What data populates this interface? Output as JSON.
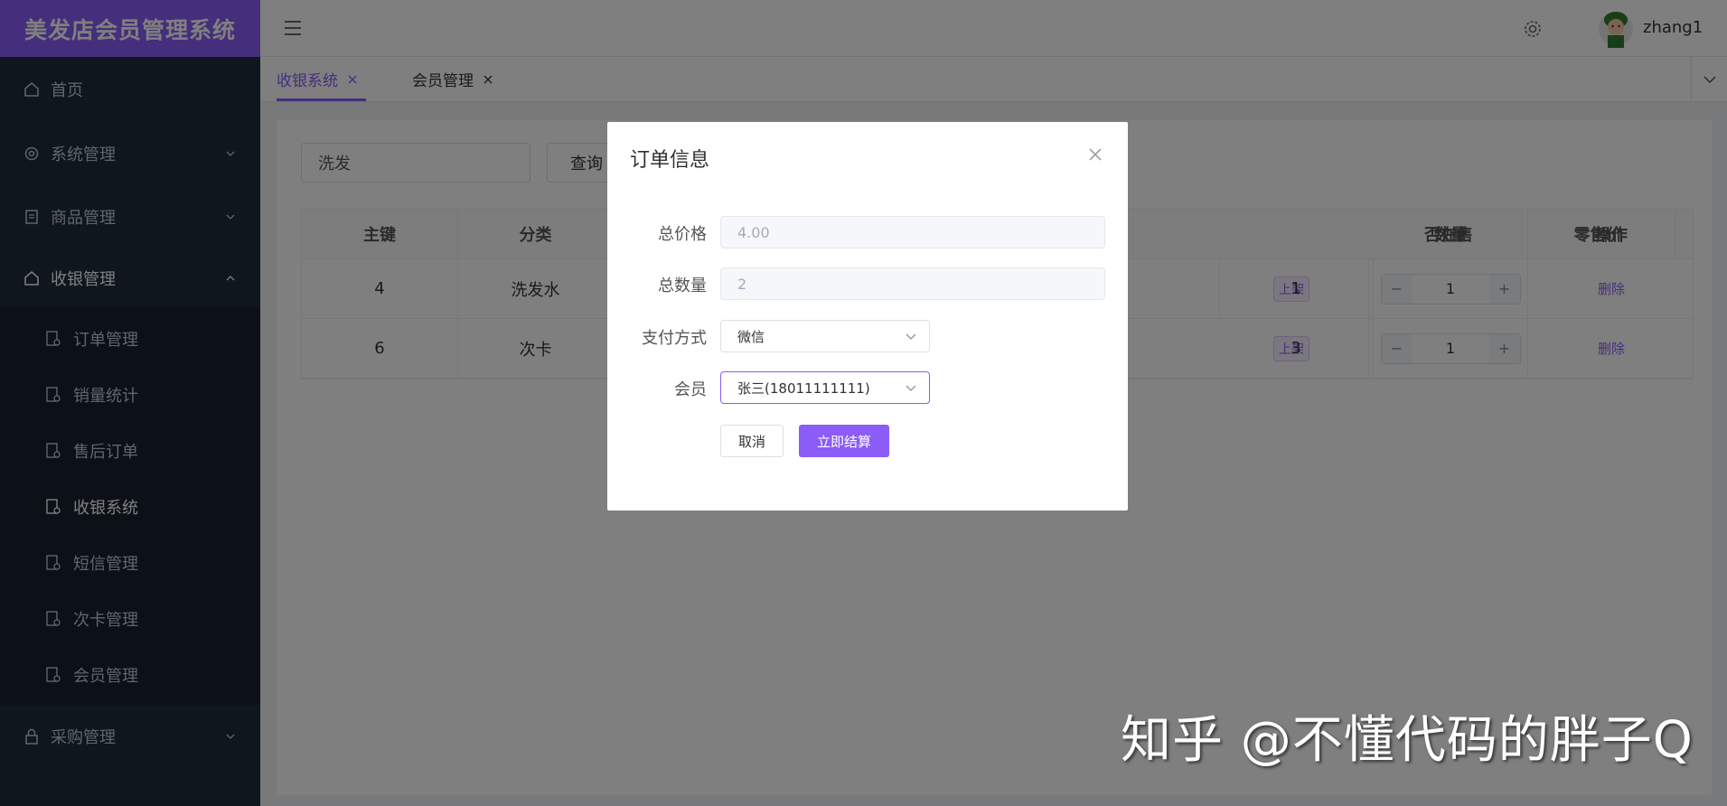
{
  "app": {
    "title": "美发店会员管理系统"
  },
  "sidebar": {
    "items": [
      {
        "label": "首页",
        "icon": "home-icon"
      },
      {
        "label": "系统管理",
        "icon": "gear-icon"
      },
      {
        "label": "商品管理",
        "icon": "document-icon"
      },
      {
        "label": "收银管理",
        "icon": "home-icon",
        "expanded": true
      },
      {
        "label": "采购管理",
        "icon": "lock-icon"
      }
    ],
    "subitems": [
      {
        "label": "订单管理"
      },
      {
        "label": "销量统计"
      },
      {
        "label": "售后订单"
      },
      {
        "label": "收银系统",
        "active": true
      },
      {
        "label": "短信管理"
      },
      {
        "label": "次卡管理"
      },
      {
        "label": "会员管理"
      }
    ]
  },
  "header": {
    "username": "zhang1"
  },
  "tabs": [
    {
      "label": "收银系统",
      "active": true
    },
    {
      "label": "会员管理"
    }
  ],
  "search": {
    "value": "洗发",
    "query_label": "查询"
  },
  "table": {
    "headers": [
      "主键",
      "分类",
      "否在售",
      "零售价",
      "数量",
      "操作"
    ],
    "rows": [
      {
        "id": "4",
        "category": "洗发水",
        "status": "上架",
        "price": "1",
        "qty": "1",
        "action": "删除"
      },
      {
        "id": "6",
        "category": "次卡",
        "status": "上架",
        "price": "3",
        "qty": "1",
        "action": "删除"
      }
    ]
  },
  "dialog": {
    "title": "订单信息",
    "total_price_label": "总价格",
    "total_price": "4.00",
    "total_qty_label": "总数量",
    "total_qty": "2",
    "payment_label": "支付方式",
    "payment": "微信",
    "member_label": "会员",
    "member": "张三(18011111111)",
    "cancel_label": "取消",
    "checkout_label": "立即结算"
  },
  "watermark": "知乎 @不懂代码的胖子Q",
  "colors": {
    "accent": "#8b5cf6",
    "sidebar": "#1f2d3d"
  }
}
